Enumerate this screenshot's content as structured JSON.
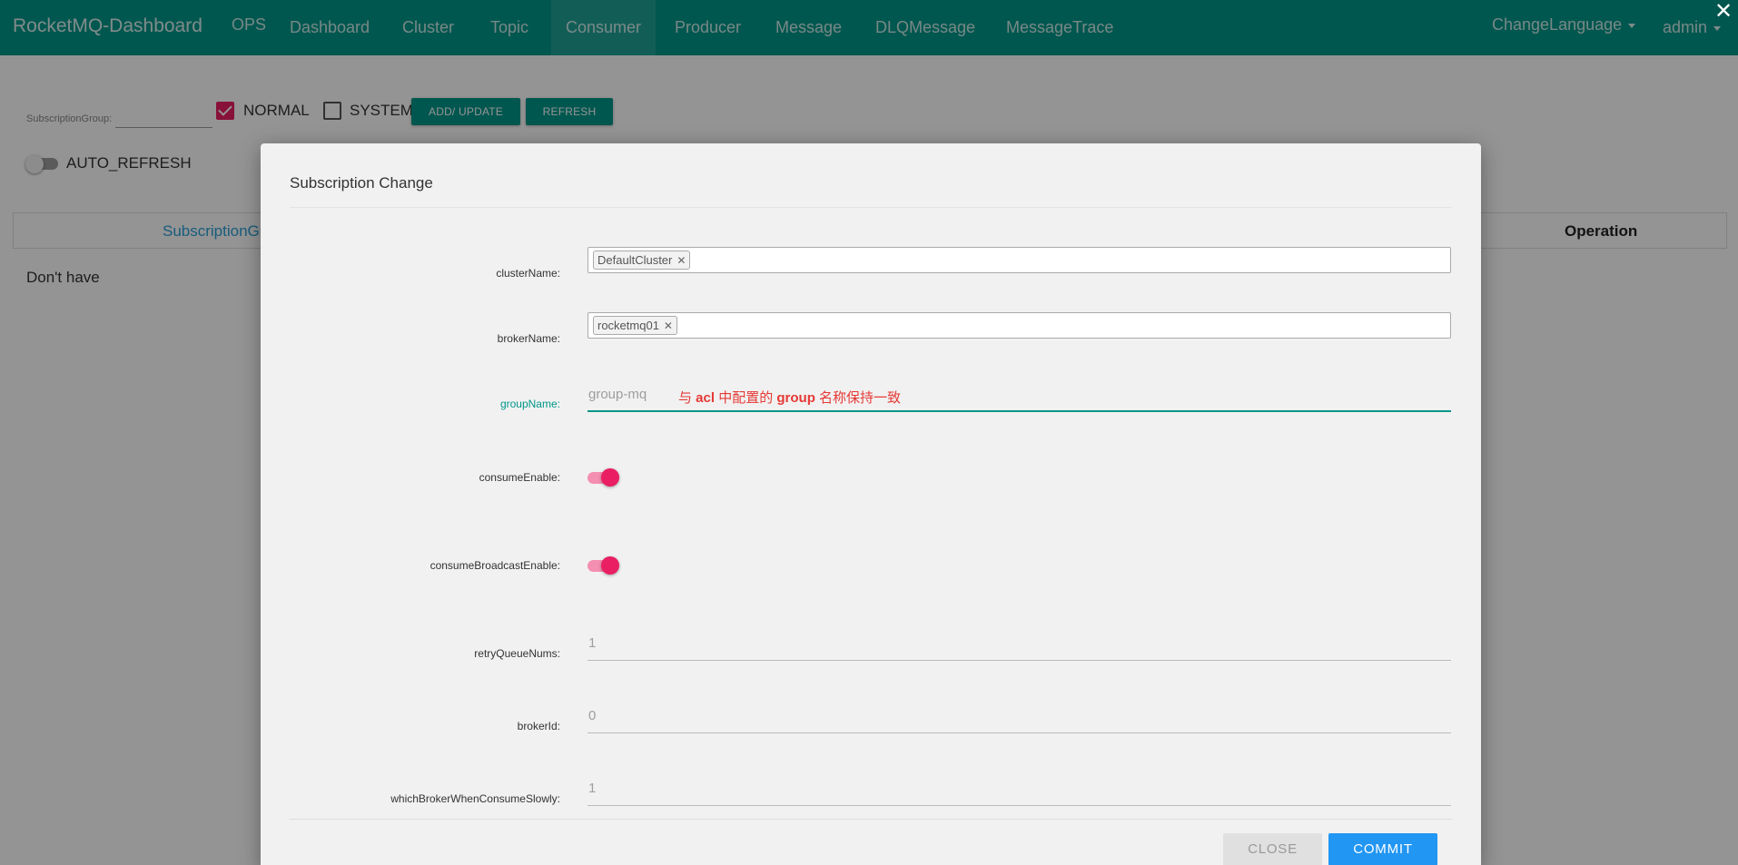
{
  "navbar": {
    "brand": "RocketMQ-Dashboard",
    "items": [
      {
        "label": "OPS"
      },
      {
        "label": "Dashboard"
      },
      {
        "label": "Cluster"
      },
      {
        "label": "Topic"
      },
      {
        "label": "Consumer",
        "active": true
      },
      {
        "label": "Producer"
      },
      {
        "label": "Message"
      },
      {
        "label": "DLQMessage"
      },
      {
        "label": "MessageTrace"
      }
    ],
    "change_language": "ChangeLanguage",
    "user": "admin",
    "close_glyph": "✕"
  },
  "filter": {
    "subscription_group_label": "SubscriptionGroup:",
    "subscription_group_value": "",
    "normal_label": "NORMAL",
    "normal_checked": true,
    "system_label": "SYSTEM",
    "system_checked": false,
    "add_update_label": "ADD/ UPDATE",
    "refresh_label": "REFRESH",
    "auto_refresh_label": "AUTO_REFRESH",
    "auto_refresh_on": false
  },
  "table": {
    "columns": [
      "SubscriptionGroup",
      "Operation"
    ],
    "empty_text": "Don't have"
  },
  "modal": {
    "title": "Subscription Change",
    "fields": {
      "cluster_name": {
        "label": "clusterName:",
        "tags": [
          "DefaultCluster"
        ]
      },
      "broker_name": {
        "label": "brokerName:",
        "tags": [
          "rocketmq01"
        ]
      },
      "group_name": {
        "label": "groupName:",
        "value": "group-mq"
      },
      "consume_enable": {
        "label": "consumeEnable:",
        "on": true
      },
      "consume_broadcast_enable": {
        "label": "consumeBroadcastEnable:",
        "on": true
      },
      "retry_queue_nums": {
        "label": "retryQueueNums:",
        "value": "1"
      },
      "broker_id": {
        "label": "brokerId:",
        "value": "0"
      },
      "which_broker_when_consume_slowly": {
        "label": "whichBrokerWhenConsumeSlowly:",
        "value": "1"
      }
    },
    "annotation": {
      "part1": "与 ",
      "part2": "acl",
      "part3": " 中配置的 ",
      "part4": "group",
      "part5": " 名称保持一致"
    },
    "close_label": "CLOSE",
    "commit_label": "COMMIT"
  },
  "colors": {
    "primary": "#009688",
    "accent_pink": "#e91e63",
    "commit_blue": "#2196f3",
    "annotation_red": "#e53935"
  }
}
